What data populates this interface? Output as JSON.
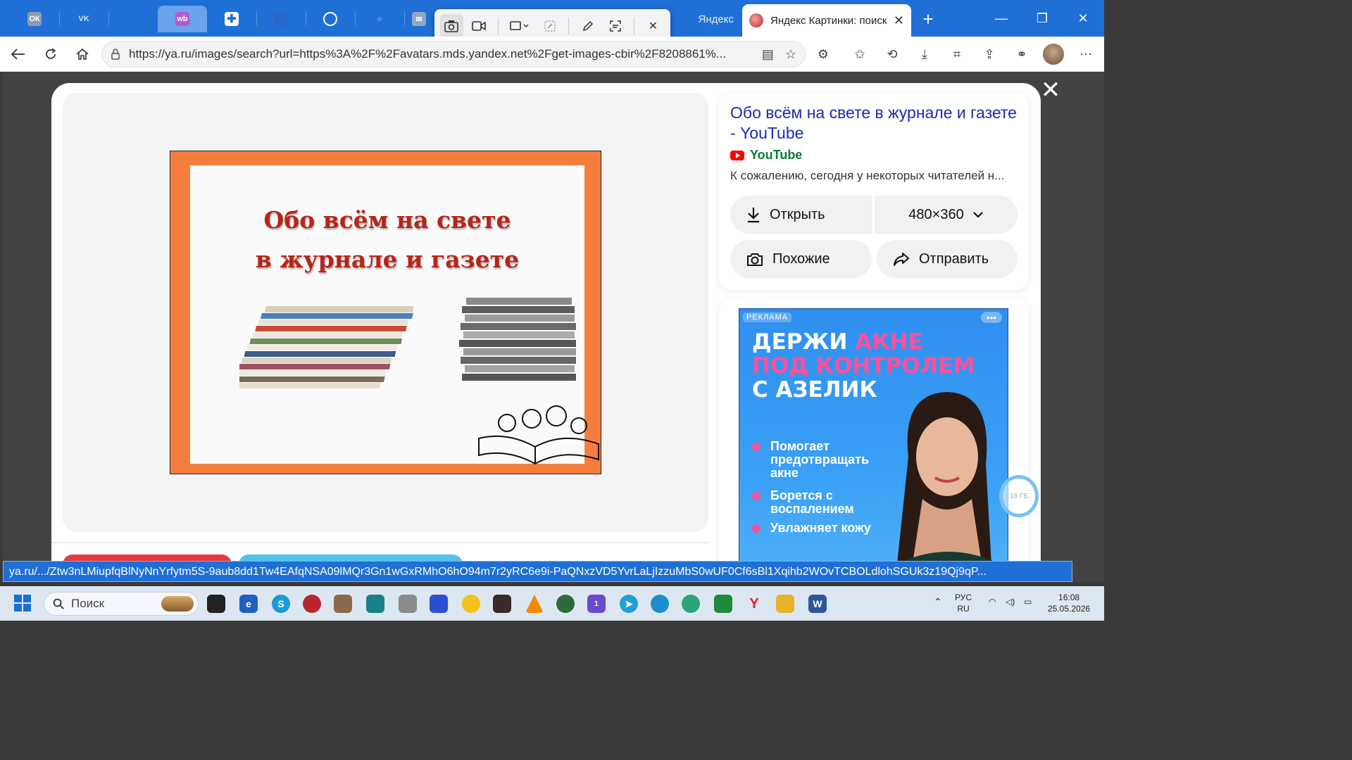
{
  "browser": {
    "tabs_partial_label": "Яндекс",
    "active_tab_title": "Яндекс Картинки: поиск",
    "url": "https://ya.ru/images/search?url=https%3A%2F%2Favatars.mds.yandex.net%2Fget-images-cbir%2F8208861%...",
    "window_controls": {
      "minimize": "—",
      "restore": "❐",
      "close": "✕"
    },
    "status_url": "ya.ru/.../Ztw3nLMiupfqBlNyNnYrfytm5S-9aub8dd1Tw4EAfqNSA09lMQr3Gn1wGxRMhO6hO94m7r2yRC6e9i-PaQNxzVD5YvrLaLjIzzuMbS0wUF0Cf6sBl1Xqihb2WOvTCBOLdlohSGUk3z19Qj9qP..."
  },
  "result": {
    "poster_line1": "Обо всём на свете",
    "poster_line2": "в журнале и газете",
    "title": "Обо всём на свете в журнале и газете - YouTube",
    "source": "YouTube",
    "description": "К сожалению, сегодня у некоторых читателей н...",
    "open_label": "Открыть",
    "size_label": "480×360",
    "similar_label": "Похожие",
    "share_label": "Отправить"
  },
  "ad": {
    "label": "РЕКЛАМА",
    "more": "•••",
    "headline_line1_white": "ДЕРЖИ ",
    "headline_line1_pink": "АКНЕ",
    "headline_line2_pink": "ПОД КОНТРОЛЕМ",
    "headline_line3": "С АЗЕЛИК",
    "bullets": [
      "Помогает предотвращать акне",
      "Борется с воспалением",
      "Увлажняет кожу"
    ],
    "storage_badge": "18 ГБ"
  },
  "taskbar": {
    "search_placeholder": "Поиск",
    "lang_top": "РУС",
    "lang_bottom": "RU",
    "time": "16:08",
    "date": "25.05.2026",
    "notification_count": "1"
  },
  "colors": {
    "accent_blue": "#1f6fd6",
    "yandex_link": "#1a2dae",
    "youtube_red": "#ff0000",
    "source_green": "#0c7a2e",
    "poster_orange": "#f57e3e",
    "poster_title_red": "#b72418",
    "ad_blue": "#2f8ff0",
    "ad_pink": "#ff4f9a"
  }
}
